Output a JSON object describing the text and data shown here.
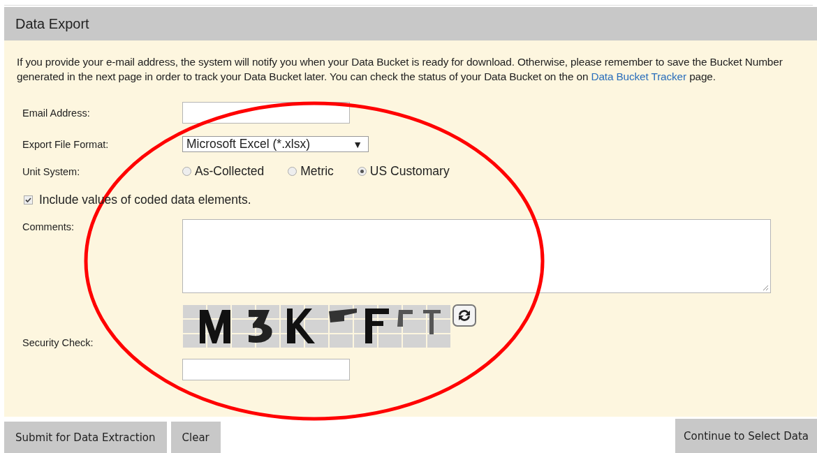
{
  "panel": {
    "title": "Data Export",
    "intro": {
      "text": "If you provide your e-mail address, the system will notify you when your Data Bucket is ready for download. Otherwise, please remember to save the Bucket Number generated in the next page in order to track your Data Bucket later. You can check the status of your Data Bucket on the on ",
      "link": "Data Bucket Tracker",
      "after": " page."
    },
    "fields": [
      {
        "kind": "text",
        "label": "Email Address:"
      },
      {
        "kind": "select",
        "label": "Export File Format:",
        "value": "Microsoft Excel (*.xlsx)",
        "arrow": "▼"
      },
      {
        "kind": "radio",
        "label": "Unit System:",
        "options": [
          {
            "label": "As-Collected",
            "selected": false
          },
          {
            "label": "Metric",
            "selected": false
          },
          {
            "label": "US Customary",
            "selected": true
          }
        ]
      },
      {
        "kind": "checkbox",
        "label": "Include values of coded data elements.",
        "checked": true
      },
      {
        "kind": "textarea",
        "label": "Comments:"
      },
      {
        "kind": "captcha",
        "label": "Security Check:"
      }
    ]
  },
  "buttons": [
    {
      "label": "Submit for Data Extraction"
    },
    {
      "label": "Clear"
    },
    {
      "label": "Continue to Select Data"
    }
  ]
}
